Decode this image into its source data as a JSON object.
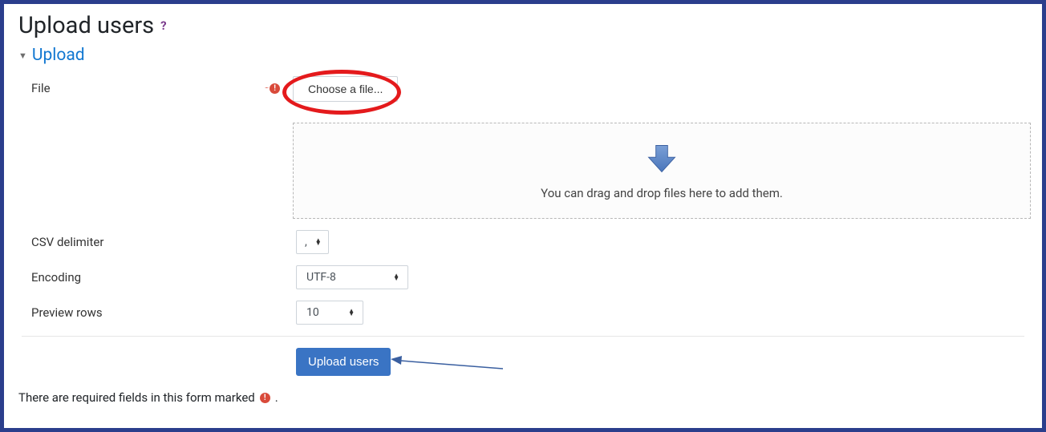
{
  "page": {
    "title": "Upload users"
  },
  "section": {
    "title": "Upload"
  },
  "form": {
    "file": {
      "label": "File",
      "button": "Choose a file..."
    },
    "dropzone": {
      "text": "You can drag and drop files here to add them."
    },
    "csv_delimiter": {
      "label": "CSV delimiter",
      "value": ","
    },
    "encoding": {
      "label": "Encoding",
      "value": "UTF-8"
    },
    "preview_rows": {
      "label": "Preview rows",
      "value": "10"
    },
    "submit": {
      "label": "Upload users"
    }
  },
  "footer": {
    "required_note_prefix": "There are required fields in this form marked",
    "required_note_suffix": "."
  }
}
